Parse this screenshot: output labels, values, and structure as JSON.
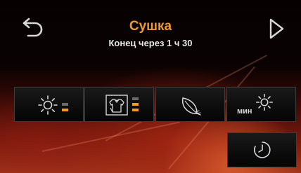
{
  "header": {
    "title": "Сушка",
    "subtitle": "Конец через 1 ч 30"
  },
  "colors": {
    "accent": "#f09a2e",
    "bar_off": "#6a6a6a",
    "icon": "#d8d8d8"
  },
  "options": [
    {
      "icon": "sun-icon",
      "level": 1,
      "levels": 2
    },
    {
      "icon": "shirt-icon",
      "level": 2,
      "levels": 3
    },
    {
      "icon": "feather-icon"
    },
    {
      "icon": "sun-icon",
      "label": "мин"
    }
  ],
  "timer_button": {
    "icon": "clock-icon"
  }
}
